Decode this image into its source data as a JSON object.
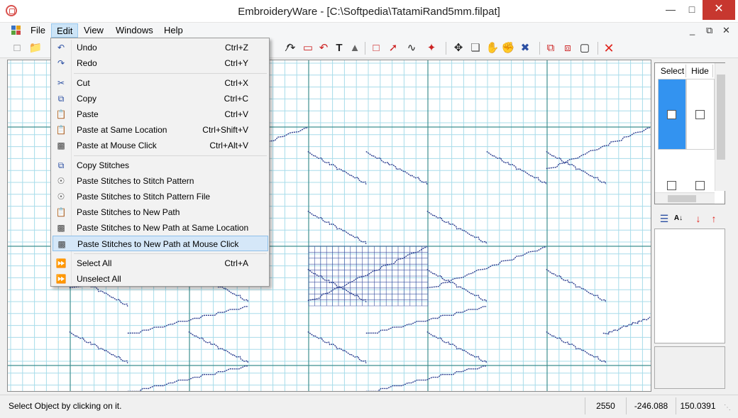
{
  "window": {
    "title": "EmbroideryWare - [C:\\Softpedia\\TatamiRand5mm.filpat]",
    "close_color": "#c7372f"
  },
  "menubar": {
    "items": [
      "File",
      "Edit",
      "View",
      "Windows",
      "Help"
    ],
    "active": "Edit"
  },
  "toolbar": {
    "icons": [
      "new-file-icon",
      "open-folder-icon",
      "save-icon",
      "line-tool-icon",
      "curve-tool-icon",
      "rectangle-tool-icon",
      "arc-tool-icon",
      "text-tool-icon",
      "fill-tool-icon",
      "select-box-icon",
      "bezier-tool-icon",
      "path-tool-icon",
      "stitch-tool-icon",
      "move-icon",
      "pan-hand-icon",
      "grab-icon",
      "edit-node-icon",
      "duplicate-icon",
      "combine-icon",
      "frame-icon",
      "delete-icon"
    ]
  },
  "edit_menu": {
    "items": [
      {
        "label": "Undo",
        "shortcut": "Ctrl+Z",
        "icon": "undo-icon"
      },
      {
        "label": "Redo",
        "shortcut": "Ctrl+Y",
        "icon": "redo-icon"
      },
      {
        "label": "Cut",
        "shortcut": "Ctrl+X",
        "icon": "cut-icon"
      },
      {
        "label": "Copy",
        "shortcut": "Ctrl+C",
        "icon": "copy-icon"
      },
      {
        "label": "Paste",
        "shortcut": "Ctrl+V",
        "icon": "paste-icon"
      },
      {
        "label": "Paste at Same Location",
        "shortcut": "Ctrl+Shift+V",
        "icon": "paste-same-location-icon"
      },
      {
        "label": "Paste at Mouse Click",
        "shortcut": "Ctrl+Alt+V",
        "icon": "paste-mouse-click-icon"
      },
      {
        "label": "Copy Stitches",
        "shortcut": "",
        "icon": "copy-stitches-icon"
      },
      {
        "label": "Paste Stitches to Stitch Pattern",
        "shortcut": "",
        "icon": "stitch-pattern-icon"
      },
      {
        "label": "Paste Stitches to Stitch Pattern File",
        "shortcut": "",
        "icon": "stitch-pattern-file-icon"
      },
      {
        "label": "Paste Stitches to New Path",
        "shortcut": "",
        "icon": "new-path-icon"
      },
      {
        "label": "Paste Stitches to New Path at Same Location",
        "shortcut": "",
        "icon": "new-path-same-location-icon"
      },
      {
        "label": "Paste Stitches to New Path at Mouse Click",
        "shortcut": "",
        "icon": "new-path-mouse-click-icon"
      },
      {
        "label": "Select All",
        "shortcut": "Ctrl+A",
        "icon": "select-all-icon"
      },
      {
        "label": "Unselect All",
        "shortcut": "",
        "icon": "unselect-all-icon"
      }
    ],
    "highlighted": "Paste Stitches to New Path at Mouse Click"
  },
  "object_panel": {
    "select_header": "Select",
    "hide_header": "Hide",
    "selected_row_color": "#3393f0"
  },
  "canvas": {
    "grid_color": "#a8dcea",
    "major_line_color": "#3f8f8f",
    "stitch_color": "#2c3e90"
  },
  "status": {
    "message": "Select Object by clicking on it.",
    "count": "2550",
    "x": "-246.088",
    "y": "150.0391"
  }
}
